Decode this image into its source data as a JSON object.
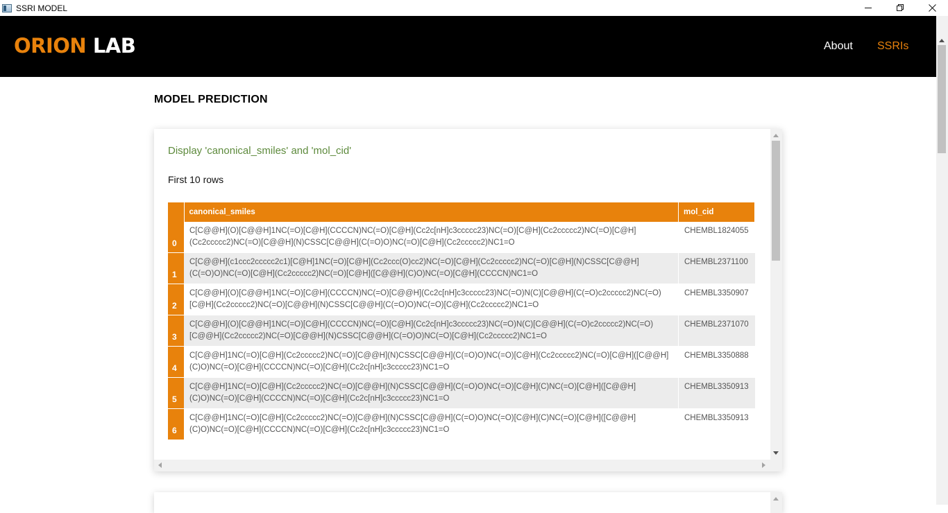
{
  "window": {
    "title": "SSRI MODEL",
    "controls": [
      "minimize",
      "restore",
      "close"
    ]
  },
  "nav": {
    "logo_part1": "ORION",
    "logo_part2": "LAB",
    "links": [
      {
        "label": "About",
        "active": false
      },
      {
        "label": "SSRIs",
        "active": true
      }
    ]
  },
  "colors": {
    "accent": "#e8820c",
    "nav_bg": "#000000",
    "display_title": "#5d8a3c",
    "row_alt": "#ececec"
  },
  "section_title": "MODEL PREDICTION",
  "card": {
    "display_title": "Display 'canonical_smiles' and 'mol_cid'",
    "rows_note": "First 10 rows",
    "columns": [
      "",
      "canonical_smiles",
      "mol_cid"
    ],
    "rows": [
      {
        "index": "0",
        "smiles": "C[C@@H](O)[C@@H]1NC(=O)[C@H](CCCCN)NC(=O)[C@H](Cc2c[nH]c3ccccc23)NC(=O)[C@H](Cc2ccccc2)NC(=O)[C@H](Cc2ccccc2)NC(=O)[C@@H](N)CSSC[C@@H](C(=O)O)NC(=O)[C@H](Cc2ccccc2)NC1=O",
        "cid": "CHEMBL1824055"
      },
      {
        "index": "1",
        "smiles": "C[C@@H](c1ccc2ccccc2c1)[C@H]1NC(=O)[C@H](Cc2ccc(O)cc2)NC(=O)[C@H](Cc2ccccc2)NC(=O)[C@H](N)CSSC[C@@H](C(=O)O)NC(=O)[C@H](Cc2ccccc2)NC(=O)[C@H]([C@@H](C)O)NC(=O)[C@H](CCCCN)NC1=O",
        "cid": "CHEMBL2371100"
      },
      {
        "index": "2",
        "smiles": "C[C@@H](O)[C@@H]1NC(=O)[C@H](CCCCN)NC(=O)[C@@H](Cc2c[nH]c3ccccc23)NC(=O)N(C)[C@@H](C(=O)c2ccccc2)NC(=O)[C@H](Cc2ccccc2)NC(=O)[C@@H](N)CSSC[C@@H](C(=O)O)NC(=O)[C@H](Cc2ccccc2)NC1=O",
        "cid": "CHEMBL3350907"
      },
      {
        "index": "3",
        "smiles": "C[C@@H](O)[C@@H]1NC(=O)[C@H](CCCCN)NC(=O)[C@H](Cc2c[nH]c3ccccc23)NC(=O)N(C)[C@@H](C(=O)c2ccccc2)NC(=O)[C@@H](Cc2ccccc2)NC(=O)[C@@H](N)CSSC[C@@H](C(=O)O)NC(=O)[C@H](Cc2ccccc2)NC1=O",
        "cid": "CHEMBL2371070"
      },
      {
        "index": "4",
        "smiles": "C[C@@H]1NC(=O)[C@H](Cc2ccccc2)NC(=O)[C@@H](N)CSSC[C@@H](C(=O)O)NC(=O)[C@H](Cc2ccccc2)NC(=O)[C@H]([C@@H](C)O)NC(=O)[C@H](CCCCN)NC(=O)[C@H](Cc2c[nH]c3ccccc23)NC1=O",
        "cid": "CHEMBL3350888"
      },
      {
        "index": "5",
        "smiles": "C[C@@H]1NC(=O)[C@H](Cc2ccccc2)NC(=O)[C@@H](N)CSSC[C@@H](C(=O)O)NC(=O)[C@H](C)NC(=O)[C@H]([C@@H](C)O)NC(=O)[C@H](CCCCN)NC(=O)[C@H](Cc2c[nH]c3ccccc23)NC1=O",
        "cid": "CHEMBL3350913"
      },
      {
        "index": "6",
        "smiles": "C[C@@H]1NC(=O)[C@H](Cc2ccccc2)NC(=O)[C@@H](N)CSSC[C@@H](C(=O)O)NC(=O)[C@H](C)NC(=O)[C@H]([C@@H](C)O)NC(=O)[C@H](CCCCN)NC(=O)[C@H](Cc2c[nH]c3ccccc23)NC1=O",
        "cid": "CHEMBL3350913"
      }
    ]
  }
}
